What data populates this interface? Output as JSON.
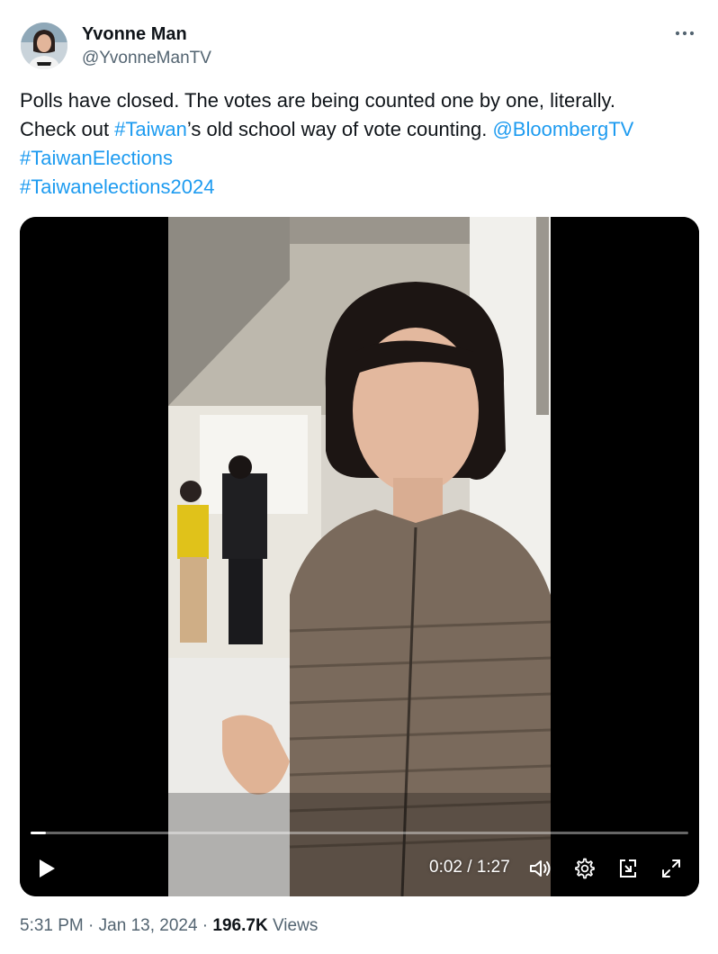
{
  "author": {
    "name": "Yvonne Man",
    "handle": "@YvonneManTV"
  },
  "menu": {
    "more_icon": "more-horizontal-icon"
  },
  "tweet": {
    "line1": "Polls have closed. The votes are being counted one by one, literally.",
    "line2_prefix": "Check out ",
    "hashtag_taiwan": "#Taiwan",
    "line2_middle": "’s old school way of vote counting. ",
    "mention": "@BloombergTV",
    "hashtag_elections": "#TaiwanElections",
    "hashtag_elections2024": "#Taiwanelections2024"
  },
  "video": {
    "current_time": "0:02",
    "separator": " / ",
    "duration": "1:27",
    "progress_fraction": 0.023,
    "controls": [
      "play-icon",
      "volume-icon",
      "settings-icon",
      "pip-icon",
      "fullscreen-icon"
    ]
  },
  "footer": {
    "time": "5:31 PM",
    "dot1": " · ",
    "date": "Jan 13, 2024",
    "dot2": " · ",
    "views_count": "196.7K",
    "views_label": " Views"
  },
  "colors": {
    "link": "#1d9bf0",
    "text": "#0f1419",
    "secondary": "#536471"
  }
}
